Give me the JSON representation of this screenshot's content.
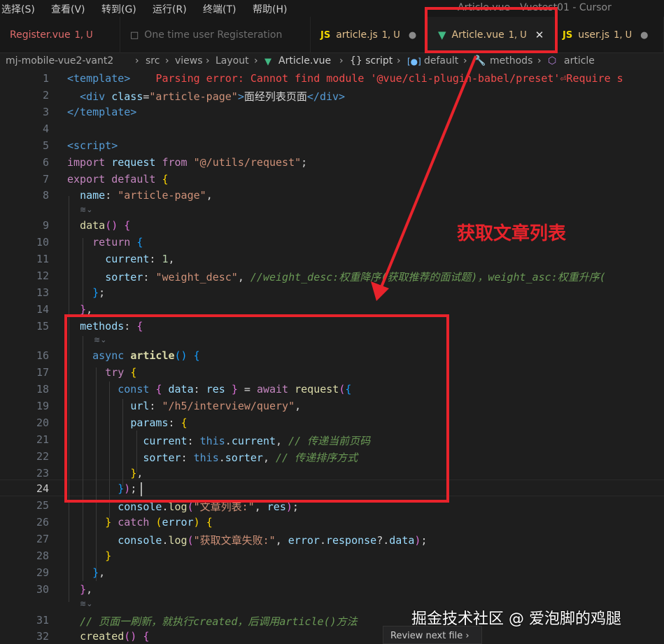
{
  "menubar": {
    "items": [
      "选择(S)",
      "查看(V)",
      "转到(G)",
      "运行(R)",
      "终端(T)",
      "帮助(H)"
    ],
    "window_title": "Article.vue - Vuetest01 - Cursor"
  },
  "tabs": [
    {
      "label": "Register.vue",
      "status": "1, U",
      "icon": "",
      "color": "#e06c6c"
    },
    {
      "label": "One time user Registeration",
      "status": "",
      "icon": "file-icon",
      "color": "#6e6e6e"
    },
    {
      "label": "article.js",
      "status": "1, U",
      "icon": "JS",
      "color": "#e2c08d"
    },
    {
      "label": "Article.vue",
      "status": "1, U",
      "icon": "vue-icon",
      "color": "#e2c08d"
    },
    {
      "label": "user.js",
      "status": "1, U",
      "icon": "JS",
      "color": "#e2c08d"
    }
  ],
  "breadcrumb": {
    "items": [
      "mj-mobile-vue2-vant2",
      "src",
      "views",
      "Layout",
      "Article.vue",
      "{} script",
      "default",
      "methods",
      "article"
    ]
  },
  "editor": {
    "lines": [
      {
        "n": "1",
        "text": ""
      },
      {
        "n": "2",
        "text": ""
      },
      {
        "n": "3",
        "text": ""
      },
      {
        "n": "4",
        "text": ""
      },
      {
        "n": "5",
        "text": ""
      },
      {
        "n": "6",
        "text": ""
      },
      {
        "n": "7",
        "text": ""
      },
      {
        "n": "8",
        "text": ""
      },
      {
        "n": "9",
        "text": ""
      },
      {
        "n": "10",
        "text": ""
      },
      {
        "n": "11",
        "text": ""
      },
      {
        "n": "12",
        "text": ""
      },
      {
        "n": "13",
        "text": ""
      },
      {
        "n": "14",
        "text": ""
      },
      {
        "n": "15",
        "text": ""
      },
      {
        "n": "16",
        "text": ""
      },
      {
        "n": "17",
        "text": ""
      },
      {
        "n": "18",
        "text": ""
      },
      {
        "n": "19",
        "text": ""
      },
      {
        "n": "20",
        "text": ""
      },
      {
        "n": "21",
        "text": ""
      },
      {
        "n": "22",
        "text": ""
      },
      {
        "n": "23",
        "text": ""
      },
      {
        "n": "24",
        "text": ""
      },
      {
        "n": "25",
        "text": ""
      },
      {
        "n": "26",
        "text": ""
      },
      {
        "n": "27",
        "text": ""
      },
      {
        "n": "28",
        "text": ""
      },
      {
        "n": "29",
        "text": ""
      },
      {
        "n": "30",
        "text": ""
      },
      {
        "n": "31",
        "text": ""
      },
      {
        "n": "32",
        "text": ""
      }
    ],
    "code": {
      "l1_tag": "<template>",
      "l1_error": "Parsing error: Cannot find module '@vue/cli-plugin-babel/preset'⏎Require s",
      "l2_open": "<div",
      "l2_attr": "class",
      "l2_val": "\"article-page\"",
      "l2_text": "面经列表页面",
      "l2_close": "</div>",
      "l3": "</template>",
      "l5": "<script>",
      "l6_import": "import",
      "l6_name": "request",
      "l6_from": "from",
      "l6_path": "\"@/utils/request\"",
      "l7_export": "export",
      "l7_default": "default",
      "l8_key": "name",
      "l8_val": "\"article-page\"",
      "l9_fn": "data",
      "l10": "return",
      "l11_key": "current",
      "l11_val": "1",
      "l12_key": "sorter",
      "l12_val": "\"weight_desc\"",
      "l12_com": "//weight_desc:权重降序(获取推荐的面试题)，weight_asc:权重升序(",
      "l15_key": "methods",
      "l16_async": "async",
      "l16_fn": "article",
      "l17": "try",
      "l18_const": "const",
      "l18_data": "data",
      "l18_res": "res",
      "l18_await": "await",
      "l18_fn": "request",
      "l19_key": "url",
      "l19_val": "\"/h5/interview/query\"",
      "l20_key": "params",
      "l21_key": "current",
      "l21_this": "this",
      "l21_prop": "current",
      "l21_com": "// 传递当前页码",
      "l22_key": "sorter",
      "l22_this": "this",
      "l22_prop": "sorter",
      "l22_com": "// 传递排序方式",
      "l25_obj": "console",
      "l25_fn": "log",
      "l25_str": "\"文章列表:\"",
      "l25_arg": "res",
      "l26_catch": "catch",
      "l26_err": "error",
      "l27_obj": "console",
      "l27_fn": "log",
      "l27_str": "\"获取文章失败:\"",
      "l27_err": "error",
      "l27_resp": "response",
      "l27_data": "data",
      "l31_com": "// 页面一刷新，就执行created，后调用article()方法",
      "l32_fn": "created"
    },
    "current_line": "24"
  },
  "annotation": {
    "text": "获取文章列表",
    "color": "#e8232b"
  },
  "watermark": "掘金技术社区 @ 爱泡脚的鸡腿",
  "review_button": "Review next file"
}
